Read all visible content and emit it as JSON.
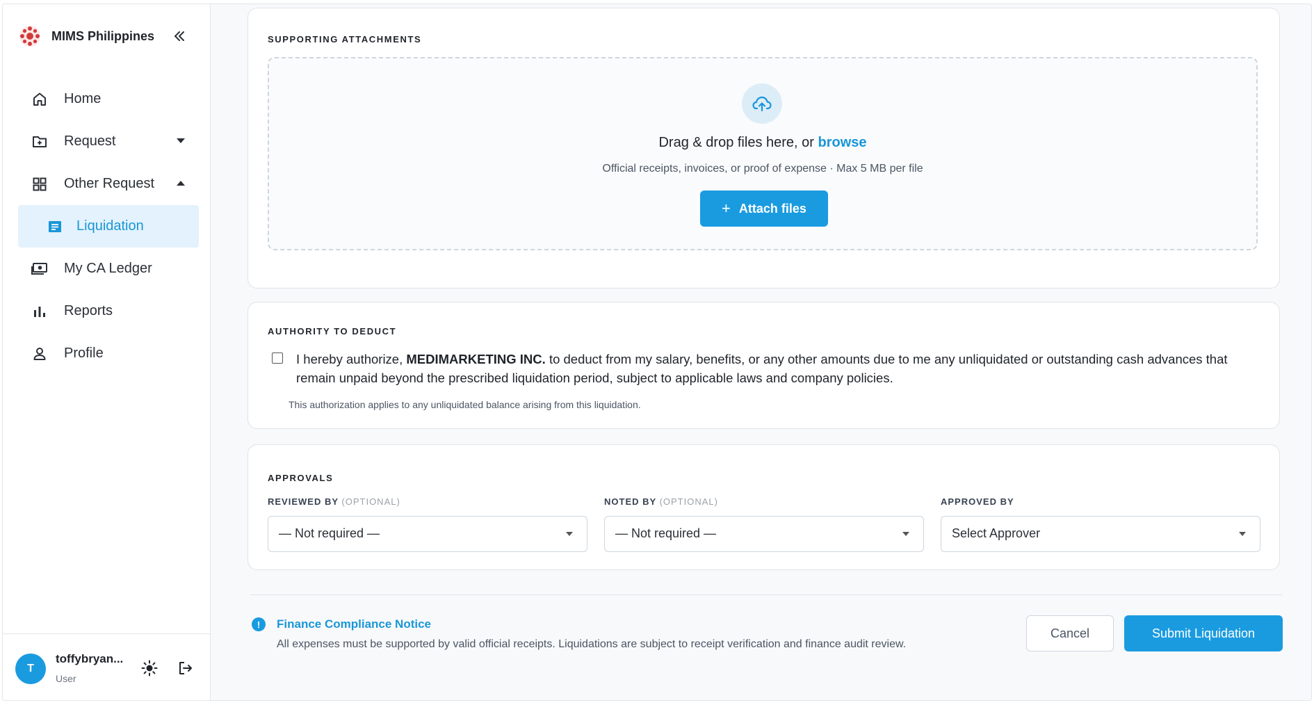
{
  "brand": {
    "name": "MIMS Philippines"
  },
  "sidebar": {
    "items": [
      {
        "label": "Home"
      },
      {
        "label": "Request"
      },
      {
        "label": "Other Request"
      },
      {
        "label": "Liquidation"
      },
      {
        "label": "My CA Ledger"
      },
      {
        "label": "Reports"
      },
      {
        "label": "Profile"
      }
    ]
  },
  "user": {
    "initial": "T",
    "name": "toffybryan...",
    "role": "User"
  },
  "attachments": {
    "title": "SUPPORTING ATTACHMENTS",
    "drop_text": "Drag & drop files here, or",
    "browse_label": "browse",
    "hint": "Official receipts, invoices, or proof of expense · Max 5 MB per file",
    "attach_plus": "+",
    "attach_label": "Attach files"
  },
  "authority": {
    "title": "AUTHORITY TO DEDUCT",
    "text_before": "I hereby authorize,",
    "company": "MEDIMARKETING INC.",
    "text_after": "to deduct from my salary, benefits, or any other amounts due to me any unliquidated or outstanding cash advances that remain unpaid beyond the prescribed liquidation period, subject to applicable laws and company policies.",
    "note": "This authorization applies to any unliquidated balance arising from this liquidation.",
    "checked": false
  },
  "approvals": {
    "title": "APPROVALS",
    "reviewed_label": "REVIEWED BY",
    "reviewed_opt": "(OPTIONAL)",
    "reviewed_value": "— Not required —",
    "noted_label": "NOTED BY",
    "noted_opt": "(OPTIONAL)",
    "noted_value": "— Not required —",
    "approved_label": "APPROVED BY",
    "approved_value": "Select Approver"
  },
  "notice": {
    "icon": "!",
    "title": "Finance Compliance Notice",
    "text": "All expenses must be supported by valid official receipts. Liquidations are subject to receipt verification and finance audit review."
  },
  "actions": {
    "cancel": "Cancel",
    "submit": "Submit Liquidation"
  },
  "colors": {
    "accent": "#1a9be0",
    "accent_text": "#1a96d8",
    "active_bg": "#e3f2fc",
    "brand_red": "#d23a3a"
  }
}
